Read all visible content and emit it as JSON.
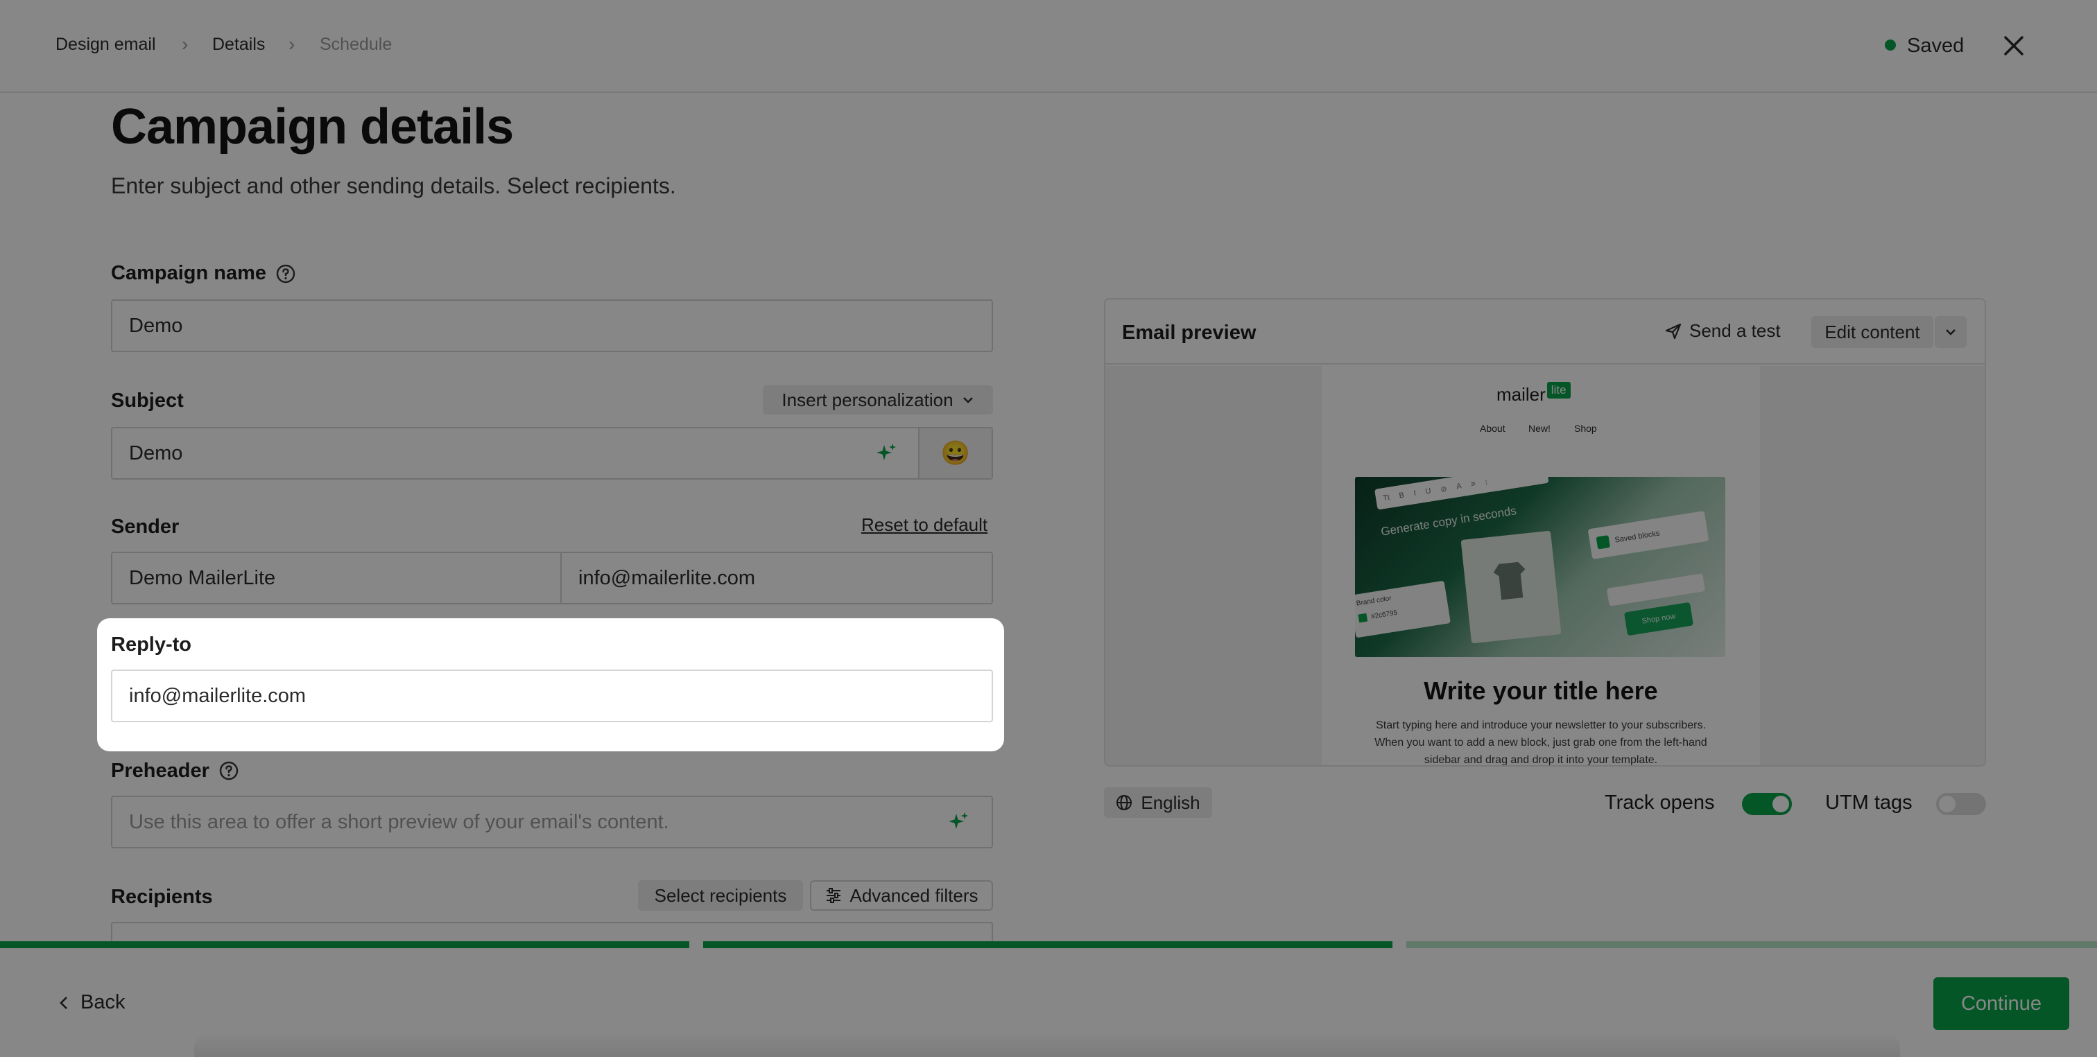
{
  "breadcrumb": {
    "items": [
      "Design email",
      "Details",
      "Schedule"
    ],
    "separator": "›"
  },
  "status": {
    "label": "Saved",
    "dot_color": "#09a34b"
  },
  "page": {
    "title": "Campaign details",
    "subtitle": "Enter subject and other sending details. Select recipients."
  },
  "campaign_name": {
    "label": "Campaign name",
    "value": "Demo"
  },
  "subject": {
    "label": "Subject",
    "value": "Demo",
    "personalization_label": "Insert personalization",
    "emoji": "😀"
  },
  "sender": {
    "label": "Sender",
    "reset_label": "Reset to default",
    "name_value": "Demo MailerLite",
    "email_value": "info@mailerlite.com"
  },
  "reply_to": {
    "label": "Reply-to",
    "value": "info@mailerlite.com"
  },
  "preheader": {
    "label": "Preheader",
    "placeholder": "Use this area to offer a short preview of your email's content."
  },
  "recipients": {
    "label": "Recipients",
    "select_label": "Select recipients",
    "filters_label": "Advanced filters"
  },
  "preview": {
    "title": "Email preview",
    "send_test_label": "Send a test",
    "edit_content_label": "Edit content",
    "logo_text": "mailer",
    "logo_badge": "lite",
    "nav": [
      "About",
      "New!",
      "Shop"
    ],
    "hero_toolbar": "Generate copy in seconds",
    "hero_saved": "Saved blocks",
    "hero_brand": "Brand color",
    "hero_hex": "#2c6795",
    "hero_shop": "Shop now",
    "email_title": "Write your title here",
    "email_body": "Start typing here and introduce your newsletter to your subscribers. When you want to add a new block, just grab one from the left-hand sidebar and drag and drop it into your template."
  },
  "language": {
    "label": "English"
  },
  "track_opens": {
    "label": "Track opens",
    "enabled": true
  },
  "utm_tags": {
    "label": "UTM tags",
    "enabled": false
  },
  "progress": {
    "steps": 3,
    "completed": 2
  },
  "footer": {
    "back_label": "Back",
    "continue_label": "Continue"
  },
  "colors": {
    "accent": "#09a34b",
    "accent_light": "#b7e4c7"
  }
}
